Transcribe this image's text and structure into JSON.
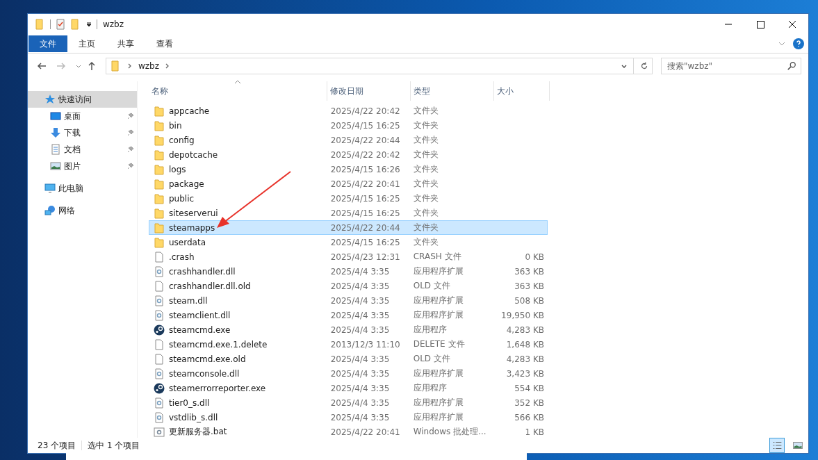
{
  "window": {
    "title": "wzbz"
  },
  "ribbon_tabs": [
    {
      "label": "文件",
      "selected": true
    },
    {
      "label": "主页",
      "selected": false
    },
    {
      "label": "共享",
      "selected": false
    },
    {
      "label": "查看",
      "selected": false
    }
  ],
  "address": {
    "path": [
      "wzbz"
    ]
  },
  "search": {
    "placeholder": "搜索\"wzbz\""
  },
  "nav": [
    {
      "label": "快速访问",
      "kind": "quick",
      "selected": true,
      "children": [
        {
          "label": "桌面",
          "kind": "desktop",
          "selected": false,
          "pinned": true
        },
        {
          "label": "下载",
          "kind": "download",
          "selected": false,
          "pinned": true
        },
        {
          "label": "文档",
          "kind": "documents",
          "selected": false,
          "pinned": true
        },
        {
          "label": "图片",
          "kind": "pictures",
          "selected": false,
          "pinned": true
        }
      ]
    },
    {
      "label": "此电脑",
      "kind": "pc",
      "selected": false
    },
    {
      "label": "网络",
      "kind": "network",
      "selected": false
    }
  ],
  "table": {
    "columns": [
      "名称",
      "修改日期",
      "类型",
      "大小"
    ],
    "rows": [
      {
        "kind": "folder",
        "name": "appcache",
        "date": "2025/4/22 20:42",
        "type": "文件夹",
        "size": "",
        "selected": false
      },
      {
        "kind": "folder",
        "name": "bin",
        "date": "2025/4/15 16:25",
        "type": "文件夹",
        "size": "",
        "selected": false
      },
      {
        "kind": "folder",
        "name": "config",
        "date": "2025/4/22 20:44",
        "type": "文件夹",
        "size": "",
        "selected": false
      },
      {
        "kind": "folder",
        "name": "depotcache",
        "date": "2025/4/22 20:42",
        "type": "文件夹",
        "size": "",
        "selected": false
      },
      {
        "kind": "folder",
        "name": "logs",
        "date": "2025/4/15 16:26",
        "type": "文件夹",
        "size": "",
        "selected": false
      },
      {
        "kind": "folder",
        "name": "package",
        "date": "2025/4/22 20:41",
        "type": "文件夹",
        "size": "",
        "selected": false
      },
      {
        "kind": "folder",
        "name": "public",
        "date": "2025/4/15 16:25",
        "type": "文件夹",
        "size": "",
        "selected": false
      },
      {
        "kind": "folder",
        "name": "siteserverui",
        "date": "2025/4/15 16:25",
        "type": "文件夹",
        "size": "",
        "selected": false
      },
      {
        "kind": "folder",
        "name": "steamapps",
        "date": "2025/4/22 20:44",
        "type": "文件夹",
        "size": "",
        "selected": true
      },
      {
        "kind": "folder",
        "name": "userdata",
        "date": "2025/4/15 16:25",
        "type": "文件夹",
        "size": "",
        "selected": false
      },
      {
        "kind": "file",
        "name": ".crash",
        "date": "2025/4/23 12:31",
        "type": "CRASH 文件",
        "size": "0 KB",
        "selected": false
      },
      {
        "kind": "dll",
        "name": "crashhandler.dll",
        "date": "2025/4/4 3:35",
        "type": "应用程序扩展",
        "size": "363 KB",
        "selected": false
      },
      {
        "kind": "file",
        "name": "crashhandler.dll.old",
        "date": "2025/4/4 3:35",
        "type": "OLD 文件",
        "size": "363 KB",
        "selected": false
      },
      {
        "kind": "dll",
        "name": "steam.dll",
        "date": "2025/4/4 3:35",
        "type": "应用程序扩展",
        "size": "508 KB",
        "selected": false
      },
      {
        "kind": "dll",
        "name": "steamclient.dll",
        "date": "2025/4/4 3:35",
        "type": "应用程序扩展",
        "size": "19,950 KB",
        "selected": false
      },
      {
        "kind": "exe",
        "name": "steamcmd.exe",
        "date": "2025/4/4 3:35",
        "type": "应用程序",
        "size": "4,283 KB",
        "selected": false
      },
      {
        "kind": "file",
        "name": "steamcmd.exe.1.delete",
        "date": "2013/12/3 11:10",
        "type": "DELETE 文件",
        "size": "1,648 KB",
        "selected": false
      },
      {
        "kind": "file",
        "name": "steamcmd.exe.old",
        "date": "2025/4/4 3:35",
        "type": "OLD 文件",
        "size": "4,283 KB",
        "selected": false
      },
      {
        "kind": "dll",
        "name": "steamconsole.dll",
        "date": "2025/4/4 3:35",
        "type": "应用程序扩展",
        "size": "3,423 KB",
        "selected": false
      },
      {
        "kind": "exe",
        "name": "steamerrorreporter.exe",
        "date": "2025/4/4 3:35",
        "type": "应用程序",
        "size": "554 KB",
        "selected": false
      },
      {
        "kind": "dll",
        "name": "tier0_s.dll",
        "date": "2025/4/4 3:35",
        "type": "应用程序扩展",
        "size": "352 KB",
        "selected": false
      },
      {
        "kind": "dll",
        "name": "vstdlib_s.dll",
        "date": "2025/4/4 3:35",
        "type": "应用程序扩展",
        "size": "566 KB",
        "selected": false
      },
      {
        "kind": "bat",
        "name": "更新服务器.bat",
        "date": "2025/4/22 20:41",
        "type": "Windows 批处理...",
        "size": "1 KB",
        "selected": false
      }
    ]
  },
  "status_bar": {
    "count": "23 个项目",
    "selection": "选中 1 个项目"
  },
  "view_buttons": [
    {
      "kind": "details",
      "selected": true
    },
    {
      "kind": "thumbnails",
      "selected": false
    }
  ]
}
